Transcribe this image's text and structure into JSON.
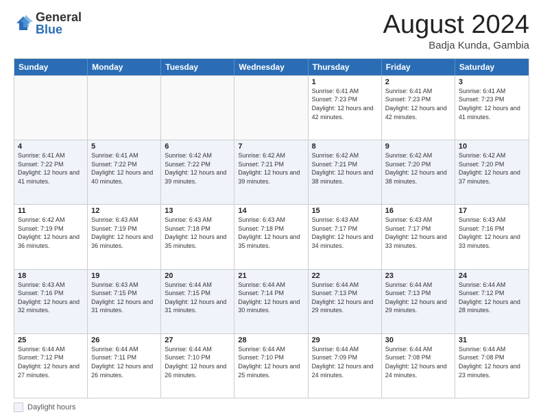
{
  "logo": {
    "general": "General",
    "blue": "Blue"
  },
  "title": "August 2024",
  "subtitle": "Badja Kunda, Gambia",
  "days_of_week": [
    "Sunday",
    "Monday",
    "Tuesday",
    "Wednesday",
    "Thursday",
    "Friday",
    "Saturday"
  ],
  "footer_label": "Daylight hours",
  "weeks": [
    [
      {
        "day": "",
        "info": ""
      },
      {
        "day": "",
        "info": ""
      },
      {
        "day": "",
        "info": ""
      },
      {
        "day": "",
        "info": ""
      },
      {
        "day": "1",
        "info": "Sunrise: 6:41 AM\nSunset: 7:23 PM\nDaylight: 12 hours and 42 minutes."
      },
      {
        "day": "2",
        "info": "Sunrise: 6:41 AM\nSunset: 7:23 PM\nDaylight: 12 hours and 42 minutes."
      },
      {
        "day": "3",
        "info": "Sunrise: 6:41 AM\nSunset: 7:23 PM\nDaylight: 12 hours and 41 minutes."
      }
    ],
    [
      {
        "day": "4",
        "info": "Sunrise: 6:41 AM\nSunset: 7:22 PM\nDaylight: 12 hours and 41 minutes."
      },
      {
        "day": "5",
        "info": "Sunrise: 6:41 AM\nSunset: 7:22 PM\nDaylight: 12 hours and 40 minutes."
      },
      {
        "day": "6",
        "info": "Sunrise: 6:42 AM\nSunset: 7:22 PM\nDaylight: 12 hours and 39 minutes."
      },
      {
        "day": "7",
        "info": "Sunrise: 6:42 AM\nSunset: 7:21 PM\nDaylight: 12 hours and 39 minutes."
      },
      {
        "day": "8",
        "info": "Sunrise: 6:42 AM\nSunset: 7:21 PM\nDaylight: 12 hours and 38 minutes."
      },
      {
        "day": "9",
        "info": "Sunrise: 6:42 AM\nSunset: 7:20 PM\nDaylight: 12 hours and 38 minutes."
      },
      {
        "day": "10",
        "info": "Sunrise: 6:42 AM\nSunset: 7:20 PM\nDaylight: 12 hours and 37 minutes."
      }
    ],
    [
      {
        "day": "11",
        "info": "Sunrise: 6:42 AM\nSunset: 7:19 PM\nDaylight: 12 hours and 36 minutes."
      },
      {
        "day": "12",
        "info": "Sunrise: 6:43 AM\nSunset: 7:19 PM\nDaylight: 12 hours and 36 minutes."
      },
      {
        "day": "13",
        "info": "Sunrise: 6:43 AM\nSunset: 7:18 PM\nDaylight: 12 hours and 35 minutes."
      },
      {
        "day": "14",
        "info": "Sunrise: 6:43 AM\nSunset: 7:18 PM\nDaylight: 12 hours and 35 minutes."
      },
      {
        "day": "15",
        "info": "Sunrise: 6:43 AM\nSunset: 7:17 PM\nDaylight: 12 hours and 34 minutes."
      },
      {
        "day": "16",
        "info": "Sunrise: 6:43 AM\nSunset: 7:17 PM\nDaylight: 12 hours and 33 minutes."
      },
      {
        "day": "17",
        "info": "Sunrise: 6:43 AM\nSunset: 7:16 PM\nDaylight: 12 hours and 33 minutes."
      }
    ],
    [
      {
        "day": "18",
        "info": "Sunrise: 6:43 AM\nSunset: 7:16 PM\nDaylight: 12 hours and 32 minutes."
      },
      {
        "day": "19",
        "info": "Sunrise: 6:43 AM\nSunset: 7:15 PM\nDaylight: 12 hours and 31 minutes."
      },
      {
        "day": "20",
        "info": "Sunrise: 6:44 AM\nSunset: 7:15 PM\nDaylight: 12 hours and 31 minutes."
      },
      {
        "day": "21",
        "info": "Sunrise: 6:44 AM\nSunset: 7:14 PM\nDaylight: 12 hours and 30 minutes."
      },
      {
        "day": "22",
        "info": "Sunrise: 6:44 AM\nSunset: 7:13 PM\nDaylight: 12 hours and 29 minutes."
      },
      {
        "day": "23",
        "info": "Sunrise: 6:44 AM\nSunset: 7:13 PM\nDaylight: 12 hours and 29 minutes."
      },
      {
        "day": "24",
        "info": "Sunrise: 6:44 AM\nSunset: 7:12 PM\nDaylight: 12 hours and 28 minutes."
      }
    ],
    [
      {
        "day": "25",
        "info": "Sunrise: 6:44 AM\nSunset: 7:12 PM\nDaylight: 12 hours and 27 minutes."
      },
      {
        "day": "26",
        "info": "Sunrise: 6:44 AM\nSunset: 7:11 PM\nDaylight: 12 hours and 26 minutes."
      },
      {
        "day": "27",
        "info": "Sunrise: 6:44 AM\nSunset: 7:10 PM\nDaylight: 12 hours and 26 minutes."
      },
      {
        "day": "28",
        "info": "Sunrise: 6:44 AM\nSunset: 7:10 PM\nDaylight: 12 hours and 25 minutes."
      },
      {
        "day": "29",
        "info": "Sunrise: 6:44 AM\nSunset: 7:09 PM\nDaylight: 12 hours and 24 minutes."
      },
      {
        "day": "30",
        "info": "Sunrise: 6:44 AM\nSunset: 7:08 PM\nDaylight: 12 hours and 24 minutes."
      },
      {
        "day": "31",
        "info": "Sunrise: 6:44 AM\nSunset: 7:08 PM\nDaylight: 12 hours and 23 minutes."
      }
    ]
  ]
}
